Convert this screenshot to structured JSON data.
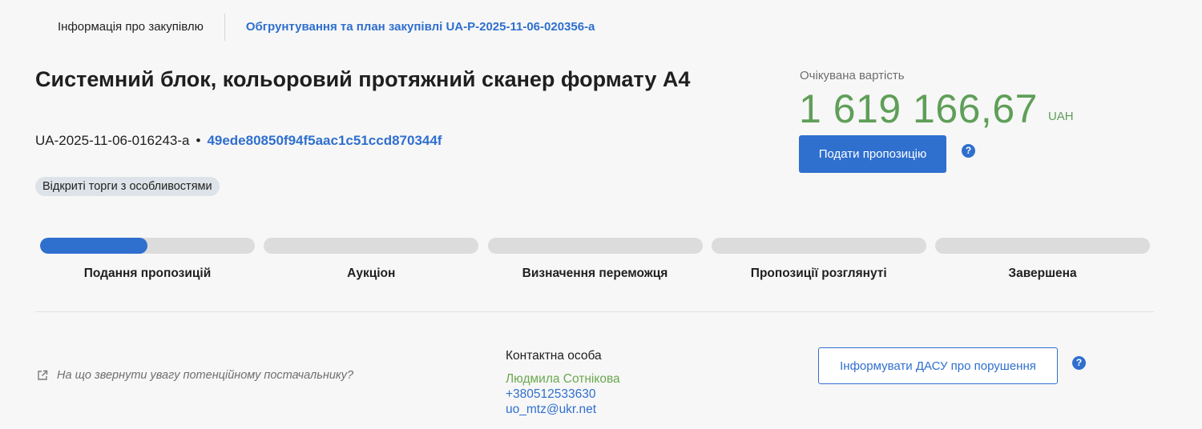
{
  "tabs": {
    "active": "Інформація про закупівлю",
    "link": "Обгрунтування та план закупівлі UA-P-2025-11-06-020356-a"
  },
  "tender": {
    "title": "Системний блок, кольоровий протяжний сканер формату А4",
    "id": "UA-2025-11-06-016243-a",
    "separator": "•",
    "hash": "49ede80850f94f5aac1c51ccd870344f",
    "procedure_badge": "Відкриті торги з особливостями"
  },
  "price": {
    "label": "Очікувана вартість",
    "value": "1 619 166,67",
    "currency": "UAH"
  },
  "actions": {
    "submit_label": "Подати пропозицію",
    "report_label": "Інформувати ДАСУ про порушення",
    "help_glyph": "?"
  },
  "stages": [
    {
      "label": "Подання пропозицій",
      "progress": 0.5
    },
    {
      "label": "Аукціон",
      "progress": 0
    },
    {
      "label": "Визначення переможця",
      "progress": 0
    },
    {
      "label": "Пропозиції розглянуті",
      "progress": 0
    },
    {
      "label": "Завершена",
      "progress": 0
    }
  ],
  "hint": {
    "icon": "external-link-icon",
    "text": "На що звернути увагу потенційному постачальнику?"
  },
  "contact": {
    "heading": "Контактна особа",
    "name": "Людмила Сотнікова",
    "phone": "+380512533630",
    "email": "uo_mtz@ukr.net"
  },
  "colors": {
    "accent": "#2f6fce",
    "price": "#5f9f58",
    "contact_name": "#6aa84f",
    "badge_bg": "#dde3e8"
  }
}
